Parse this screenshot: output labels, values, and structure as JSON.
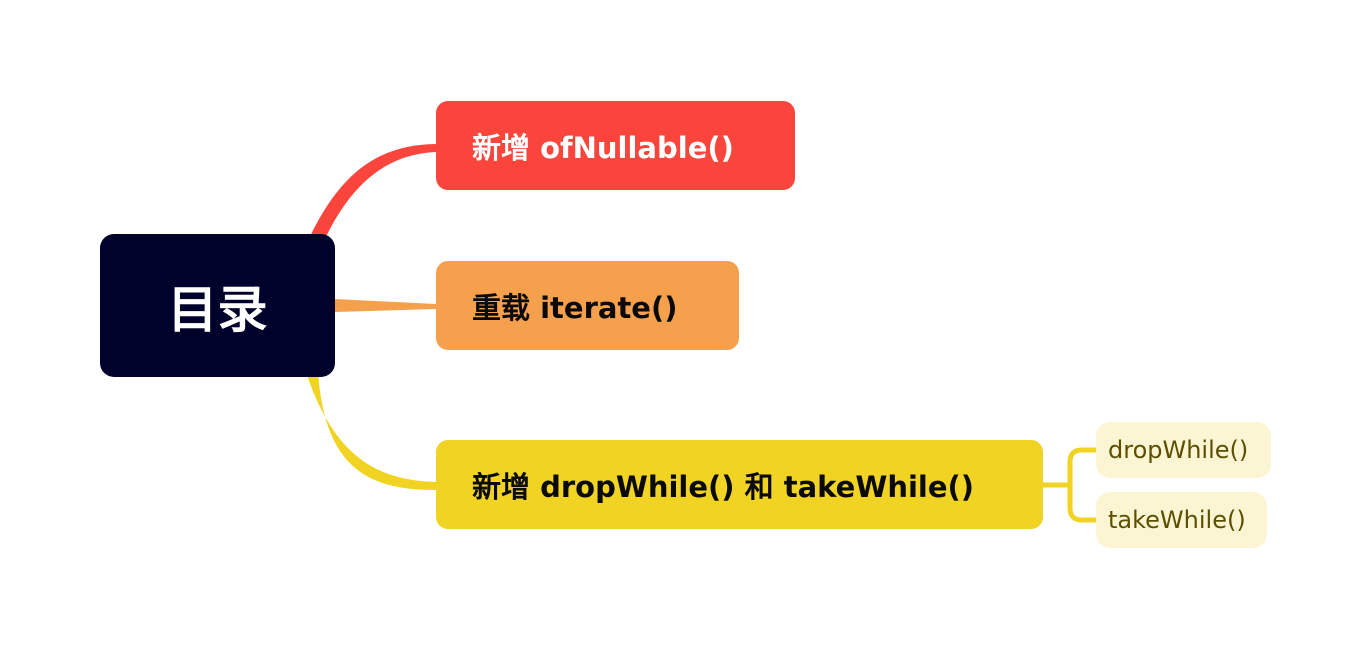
{
  "root": {
    "label": "目录"
  },
  "branches": [
    {
      "label": "新增 ofNullable()",
      "color": "#FA453D"
    },
    {
      "label": "重载 iterate()",
      "color": "#F5A04D"
    },
    {
      "label": "新增 dropWhile() 和 takeWhile()",
      "color": "#F0D323",
      "children": [
        {
          "label": "dropWhile()"
        },
        {
          "label": "takeWhile()"
        }
      ]
    }
  ]
}
